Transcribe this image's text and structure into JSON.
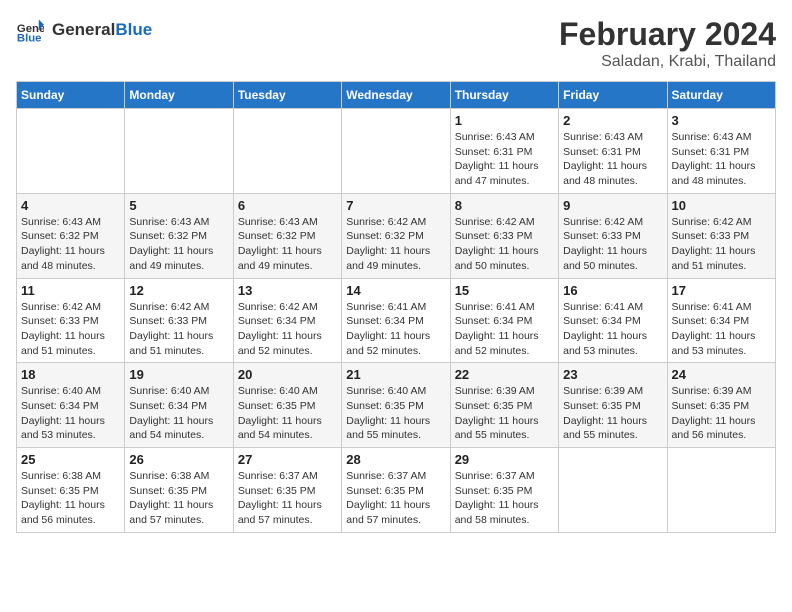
{
  "header": {
    "logo_general": "General",
    "logo_blue": "Blue",
    "month_year": "February 2024",
    "location": "Saladan, Krabi, Thailand"
  },
  "weekdays": [
    "Sunday",
    "Monday",
    "Tuesday",
    "Wednesday",
    "Thursday",
    "Friday",
    "Saturday"
  ],
  "weeks": [
    [
      {
        "day": "",
        "detail": ""
      },
      {
        "day": "",
        "detail": ""
      },
      {
        "day": "",
        "detail": ""
      },
      {
        "day": "",
        "detail": ""
      },
      {
        "day": "1",
        "detail": "Sunrise: 6:43 AM\nSunset: 6:31 PM\nDaylight: 11 hours\nand 47 minutes."
      },
      {
        "day": "2",
        "detail": "Sunrise: 6:43 AM\nSunset: 6:31 PM\nDaylight: 11 hours\nand 48 minutes."
      },
      {
        "day": "3",
        "detail": "Sunrise: 6:43 AM\nSunset: 6:31 PM\nDaylight: 11 hours\nand 48 minutes."
      }
    ],
    [
      {
        "day": "4",
        "detail": "Sunrise: 6:43 AM\nSunset: 6:32 PM\nDaylight: 11 hours\nand 48 minutes."
      },
      {
        "day": "5",
        "detail": "Sunrise: 6:43 AM\nSunset: 6:32 PM\nDaylight: 11 hours\nand 49 minutes."
      },
      {
        "day": "6",
        "detail": "Sunrise: 6:43 AM\nSunset: 6:32 PM\nDaylight: 11 hours\nand 49 minutes."
      },
      {
        "day": "7",
        "detail": "Sunrise: 6:42 AM\nSunset: 6:32 PM\nDaylight: 11 hours\nand 49 minutes."
      },
      {
        "day": "8",
        "detail": "Sunrise: 6:42 AM\nSunset: 6:33 PM\nDaylight: 11 hours\nand 50 minutes."
      },
      {
        "day": "9",
        "detail": "Sunrise: 6:42 AM\nSunset: 6:33 PM\nDaylight: 11 hours\nand 50 minutes."
      },
      {
        "day": "10",
        "detail": "Sunrise: 6:42 AM\nSunset: 6:33 PM\nDaylight: 11 hours\nand 51 minutes."
      }
    ],
    [
      {
        "day": "11",
        "detail": "Sunrise: 6:42 AM\nSunset: 6:33 PM\nDaylight: 11 hours\nand 51 minutes."
      },
      {
        "day": "12",
        "detail": "Sunrise: 6:42 AM\nSunset: 6:33 PM\nDaylight: 11 hours\nand 51 minutes."
      },
      {
        "day": "13",
        "detail": "Sunrise: 6:42 AM\nSunset: 6:34 PM\nDaylight: 11 hours\nand 52 minutes."
      },
      {
        "day": "14",
        "detail": "Sunrise: 6:41 AM\nSunset: 6:34 PM\nDaylight: 11 hours\nand 52 minutes."
      },
      {
        "day": "15",
        "detail": "Sunrise: 6:41 AM\nSunset: 6:34 PM\nDaylight: 11 hours\nand 52 minutes."
      },
      {
        "day": "16",
        "detail": "Sunrise: 6:41 AM\nSunset: 6:34 PM\nDaylight: 11 hours\nand 53 minutes."
      },
      {
        "day": "17",
        "detail": "Sunrise: 6:41 AM\nSunset: 6:34 PM\nDaylight: 11 hours\nand 53 minutes."
      }
    ],
    [
      {
        "day": "18",
        "detail": "Sunrise: 6:40 AM\nSunset: 6:34 PM\nDaylight: 11 hours\nand 53 minutes."
      },
      {
        "day": "19",
        "detail": "Sunrise: 6:40 AM\nSunset: 6:34 PM\nDaylight: 11 hours\nand 54 minutes."
      },
      {
        "day": "20",
        "detail": "Sunrise: 6:40 AM\nSunset: 6:35 PM\nDaylight: 11 hours\nand 54 minutes."
      },
      {
        "day": "21",
        "detail": "Sunrise: 6:40 AM\nSunset: 6:35 PM\nDaylight: 11 hours\nand 55 minutes."
      },
      {
        "day": "22",
        "detail": "Sunrise: 6:39 AM\nSunset: 6:35 PM\nDaylight: 11 hours\nand 55 minutes."
      },
      {
        "day": "23",
        "detail": "Sunrise: 6:39 AM\nSunset: 6:35 PM\nDaylight: 11 hours\nand 55 minutes."
      },
      {
        "day": "24",
        "detail": "Sunrise: 6:39 AM\nSunset: 6:35 PM\nDaylight: 11 hours\nand 56 minutes."
      }
    ],
    [
      {
        "day": "25",
        "detail": "Sunrise: 6:38 AM\nSunset: 6:35 PM\nDaylight: 11 hours\nand 56 minutes."
      },
      {
        "day": "26",
        "detail": "Sunrise: 6:38 AM\nSunset: 6:35 PM\nDaylight: 11 hours\nand 57 minutes."
      },
      {
        "day": "27",
        "detail": "Sunrise: 6:37 AM\nSunset: 6:35 PM\nDaylight: 11 hours\nand 57 minutes."
      },
      {
        "day": "28",
        "detail": "Sunrise: 6:37 AM\nSunset: 6:35 PM\nDaylight: 11 hours\nand 57 minutes."
      },
      {
        "day": "29",
        "detail": "Sunrise: 6:37 AM\nSunset: 6:35 PM\nDaylight: 11 hours\nand 58 minutes."
      },
      {
        "day": "",
        "detail": ""
      },
      {
        "day": "",
        "detail": ""
      }
    ]
  ]
}
